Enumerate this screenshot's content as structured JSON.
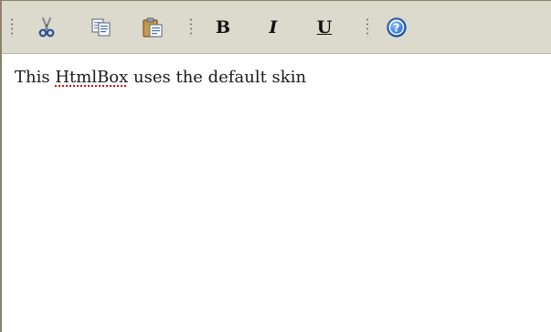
{
  "toolbar": {
    "buttons": [
      {
        "id": "cut",
        "icon": "scissors-icon"
      },
      {
        "id": "copy",
        "icon": "copy-icon"
      },
      {
        "id": "paste",
        "icon": "paste-icon"
      },
      {
        "id": "bold",
        "label": "B"
      },
      {
        "id": "italic",
        "label": "I"
      },
      {
        "id": "underline",
        "label": "U"
      },
      {
        "id": "help",
        "icon": "help-icon"
      }
    ]
  },
  "content": {
    "text_before": "This ",
    "misspelled_word": "HtmlBox",
    "text_after": " uses the default skin"
  },
  "colors": {
    "toolbar_bg": "#dcd9cd",
    "border": "#8a8268",
    "help_icon": "#2f6fd0",
    "spellcheck_underline": "#d01010"
  }
}
